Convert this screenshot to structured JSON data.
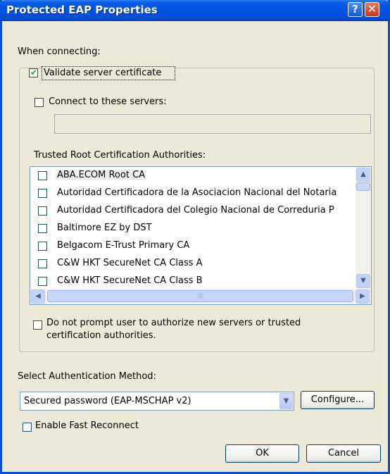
{
  "window": {
    "title": "Protected EAP Properties",
    "help_icon": "?",
    "close_icon": "✕"
  },
  "when_connecting_label": "When connecting:",
  "validate_cert": {
    "label": "Validate server certificate",
    "checked": true
  },
  "connect_servers": {
    "label": "Connect to these servers:",
    "checked": false,
    "value": ""
  },
  "trusted_root_label": "Trusted Root Certification Authorities:",
  "ca_list": [
    {
      "label": "ABA.ECOM Root CA",
      "checked": false
    },
    {
      "label": "Autoridad Certificadora de la Asociacion Nacional del Notaria",
      "checked": false
    },
    {
      "label": "Autoridad Certificadora del Colegio Nacional de Correduria P",
      "checked": false
    },
    {
      "label": "Baltimore EZ by DST",
      "checked": false
    },
    {
      "label": "Belgacom E-Trust Primary CA",
      "checked": false
    },
    {
      "label": "C&W HKT SecureNet CA Class A",
      "checked": false
    },
    {
      "label": "C&W HKT SecureNet CA Class B",
      "checked": false
    }
  ],
  "scroll_icons": {
    "up": "▲",
    "down": "▼",
    "left": "◀",
    "right": "▶",
    "grip": "|||"
  },
  "no_prompt": {
    "line1": "Do not prompt user to authorize new servers or trusted",
    "line2": "certification authorities.",
    "checked": false
  },
  "auth_method_label": "Select Authentication Method:",
  "auth_method_value": "Secured password (EAP-MSCHAP v2)",
  "dropdown_icon": "▼",
  "configure_label": "Configure...",
  "fast_reconnect": {
    "label": "Enable Fast Reconnect",
    "checked": false
  },
  "ok_label": "OK",
  "cancel_label": "Cancel"
}
